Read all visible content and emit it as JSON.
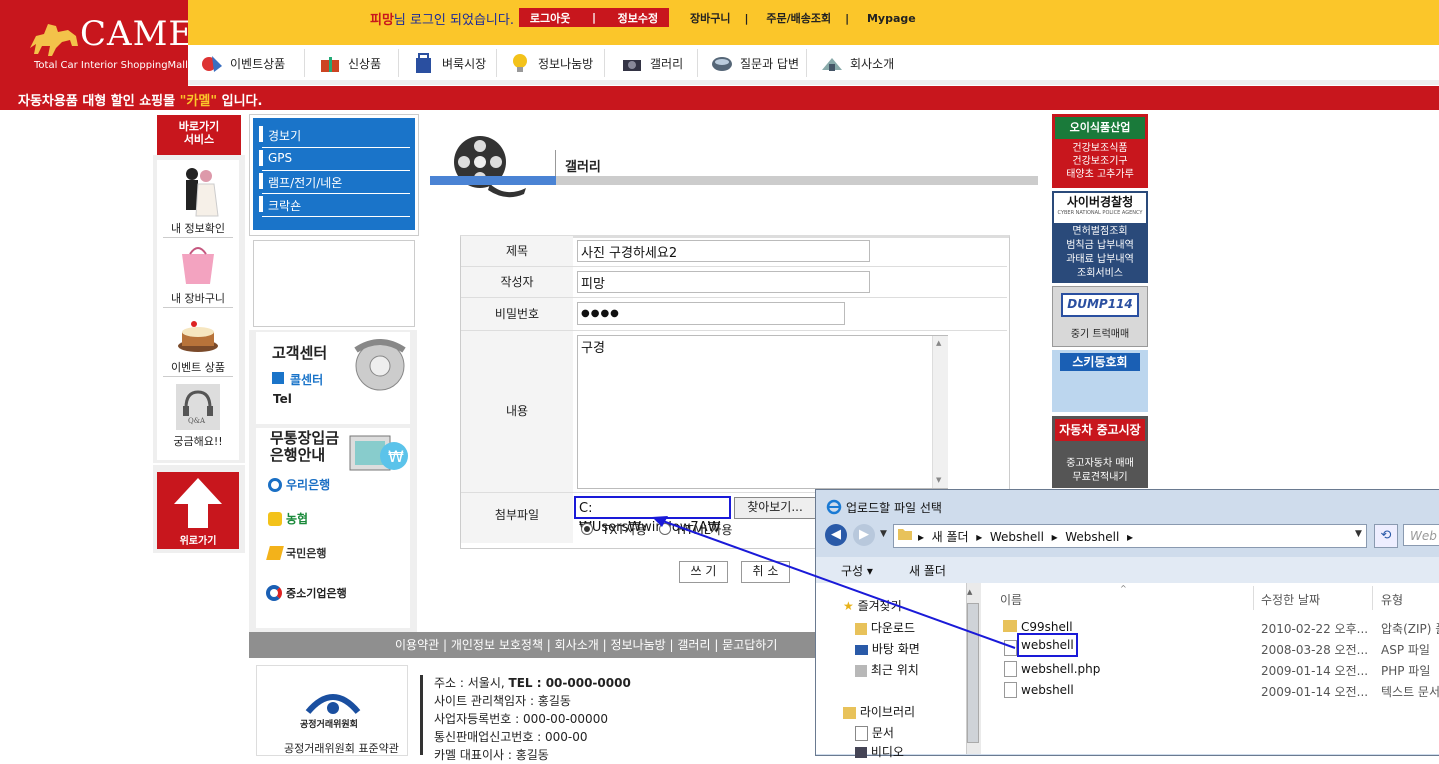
{
  "header": {
    "logo_text": "CAMEL",
    "logo_sub": "Total Car Interior ShoppingMall",
    "login_nick": "피망",
    "login_msg": "님 로그인 되었습니다.",
    "logout": "로그아웃",
    "profile_edit": "정보수정",
    "top_links": [
      "장바구니",
      "주문/배송조회",
      "Mypage"
    ],
    "nav": [
      "이벤트상품",
      "신상품",
      "벼룩시장",
      "정보나눔방",
      "갤러리",
      "질문과 답변",
      "회사소개"
    ],
    "strip_pre": "자동차용품 대형 할인 쇼핑몰 ",
    "strip_hl": "\"카멜\"",
    "strip_post": " 입니다."
  },
  "quick": {
    "head_line1": "바로가기",
    "head_line2": "서비스",
    "items": [
      "내 정보확인",
      "내 장바구니",
      "이벤트 상품",
      "궁금해요!!"
    ],
    "qa_icon_text": "Q&A",
    "top_button": "위로가기"
  },
  "categories": [
    "경보기",
    "GPS",
    "램프/전기/네온",
    "크락숀"
  ],
  "cs": {
    "title": "고객센터",
    "call": "콜센터",
    "tel": "Tel"
  },
  "bank": {
    "title_line1": "무통장입금",
    "title_line2": "은행안내",
    "banks": [
      "우리은행",
      "농협",
      "국민은행",
      "중소기업은행"
    ]
  },
  "main": {
    "title": "갤러리",
    "fields": {
      "subject_label": "제목",
      "subject_value": "사진 구경하세요2",
      "author_label": "작성자",
      "author_value": "피망",
      "password_label": "비밀번호",
      "password_value": "●●●●",
      "content_label": "내용",
      "content_value": "구경",
      "attach_label": "첨부파일",
      "attach_value": "C:₩Users₩window7A₩",
      "browse_button": "찾아보기...",
      "radio_txt": "TXT사용",
      "radio_html": "HTML사용"
    },
    "write_button": "쓰 기",
    "cancel_button": "취 소"
  },
  "banners": [
    {
      "title": "오이식품산업",
      "lines": [
        "건강보조식품",
        "건강보조기구",
        "태양초 고추가루"
      ]
    },
    {
      "title": "사이버경찰청",
      "sub": "CYBER NATIONAL POLICE AGENCY",
      "lines": [
        "면허벌점조회",
        "범칙금 납부내역",
        "과태료 납부내역",
        "조회서비스"
      ]
    },
    {
      "title": "DUMP114",
      "lines": [
        "중기 트럭매매"
      ]
    },
    {
      "title": "스키동호회",
      "lines": []
    },
    {
      "title": "자동차 중고시장",
      "lines": [
        "중고자동차 매매",
        "무료견적내기"
      ]
    }
  ],
  "footer": {
    "links": [
      "이용약관",
      "개인정보 보호정책",
      "회사소개",
      "정보나눔방",
      "갤러리",
      "묻고답하기"
    ],
    "ftc_name": "공정거래위원회",
    "ftc_caption": "공정거래위원회 표준약관",
    "address_label": "주소 : 서울시, ",
    "tel_label": "TEL : 00-000-0000",
    "admin": "사이트 관리책임자 : 홍길동",
    "biz_no": "사업자등록번호 : 000-00-00000",
    "mail_order": "통신판매업신고번호 : 000-00",
    "ceo": "카멜 대표이사 : 홍길동"
  },
  "dialog": {
    "title": "업로드할 파일 선택",
    "path": [
      "새 폴더",
      "Webshell",
      "Webshell"
    ],
    "search_placeholder": "Web",
    "organize": "구성 ▾",
    "new_folder": "새 폴더",
    "sidebar": {
      "favorites": "즐겨찾기",
      "downloads": "다운로드",
      "desktop": "바탕 화면",
      "recent": "최근 위치",
      "libraries": "라이브러리",
      "documents": "문서",
      "videos": "비디오"
    },
    "columns": [
      "이름",
      "수정한 날짜",
      "유형"
    ],
    "files": [
      {
        "name": "C99shell",
        "date": "2010-02-22 오후...",
        "type": "압축(ZIP) 폴"
      },
      {
        "name": "webshell",
        "date": "2008-03-28 오전...",
        "type": "ASP 파일"
      },
      {
        "name": "webshell.php",
        "date": "2009-01-14 오전...",
        "type": "PHP 파일"
      },
      {
        "name": "webshell",
        "date": "2009-01-14 오전...",
        "type": "텍스트 문서"
      }
    ]
  }
}
